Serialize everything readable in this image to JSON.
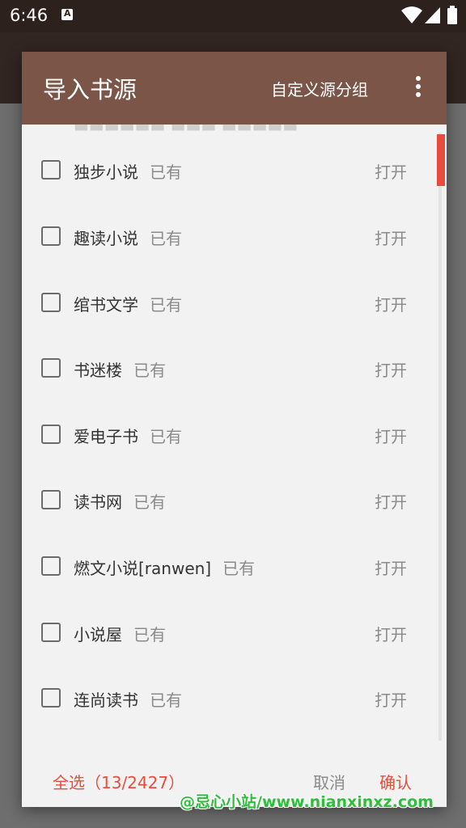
{
  "status_bar": {
    "time": "6:46",
    "icons": [
      "notification-a-icon",
      "wifi-icon",
      "signal-icon",
      "battery-icon"
    ]
  },
  "dialog": {
    "title": "导入书源",
    "group_label": "自定义源分组",
    "more_icon": "more-vert-icon"
  },
  "rows": [
    {
      "name": "独步小说",
      "status": "已有",
      "action": "打开"
    },
    {
      "name": "趣读小说",
      "status": "已有",
      "action": "打开"
    },
    {
      "name": "绾书文学",
      "status": "已有",
      "action": "打开"
    },
    {
      "name": "书迷楼",
      "status": "已有",
      "action": "打开"
    },
    {
      "name": "爱电子书",
      "status": "已有",
      "action": "打开"
    },
    {
      "name": "读书网",
      "status": "已有",
      "action": "打开"
    },
    {
      "name": "燃文小说[ranwen]",
      "status": "已有",
      "action": "打开"
    },
    {
      "name": "小说屋",
      "status": "已有",
      "action": "打开"
    },
    {
      "name": "连尚读书",
      "status": "已有",
      "action": "打开"
    }
  ],
  "footer": {
    "select_all": "全选（13/2427）",
    "cancel": "取消",
    "confirm": "确认"
  },
  "watermark": "@忌心小站/www.nianxinxz.com",
  "colors": {
    "header": "#7a5548",
    "accent": "#e84c3d",
    "dialog_bg": "#f2f2f2",
    "status_bar": "#2d211d"
  }
}
